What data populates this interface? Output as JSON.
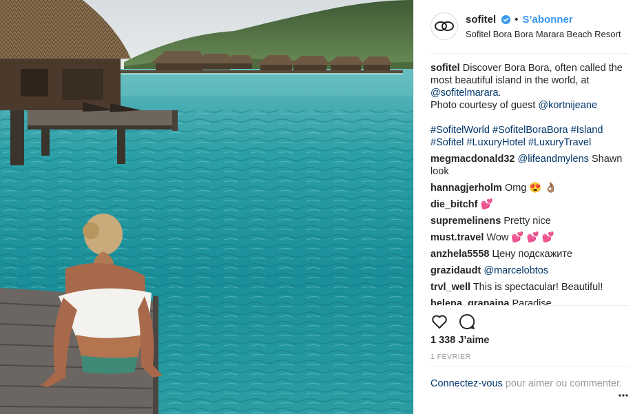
{
  "post": {
    "username": "sofitel",
    "follow_label": "S’abonner",
    "separator": "•",
    "location": "Sofitel Bora Bora Marara Beach Resort"
  },
  "caption": {
    "username": "sofitel",
    "text1": "Discover Bora Bora, often called the most beautiful island in the world, at",
    "mention1": "@sofitelmarara",
    "text2": ".",
    "text3": "Photo courtesy of guest",
    "mention2": "@kortnijeane",
    "hashtags": [
      "#SofitelWorld",
      "#SofitelBoraBora",
      "#Island",
      "#Sofitel",
      "#LuxuryHotel",
      "#LuxuryTravel"
    ]
  },
  "comments": [
    {
      "user": "megmacdonald32",
      "mention": "@lifeandmylens",
      "text": "Shawn look"
    },
    {
      "user": "hannagjerholm",
      "mention": "",
      "text": "Omg 😍 👌🏽"
    },
    {
      "user": "die_bitchf",
      "mention": "",
      "text": "💕"
    },
    {
      "user": "supremelinens",
      "mention": "",
      "text": "Pretty nice"
    },
    {
      "user": "must.travel",
      "mention": "",
      "text": "Wow 💕 💕 💕"
    },
    {
      "user": "anzhela5558",
      "mention": "",
      "text": "Цену подскажите"
    },
    {
      "user": "grazidaudt",
      "mention": "@marcelobtos",
      "text": ""
    },
    {
      "user": "trvl_well",
      "mention": "",
      "text": "This is spectacular! Beautiful!"
    },
    {
      "user": "helena_granaina",
      "mention": "",
      "text": "Paradise"
    }
  ],
  "stats": {
    "likes": "1 338 J’aime",
    "date": "1 FÉVRIER"
  },
  "login": {
    "link": "Connectez-vous",
    "text": "pour aimer ou commenter."
  },
  "icons": {
    "avatar": "sofitel-logo-icon",
    "verified": "verified-badge-icon",
    "like": "heart-icon",
    "comment": "comment-bubble-icon",
    "more": "more-options-icon"
  },
  "colors": {
    "link_blue": "#3897f0",
    "mention_blue": "#003569",
    "muted": "#999999",
    "text": "#262626"
  }
}
